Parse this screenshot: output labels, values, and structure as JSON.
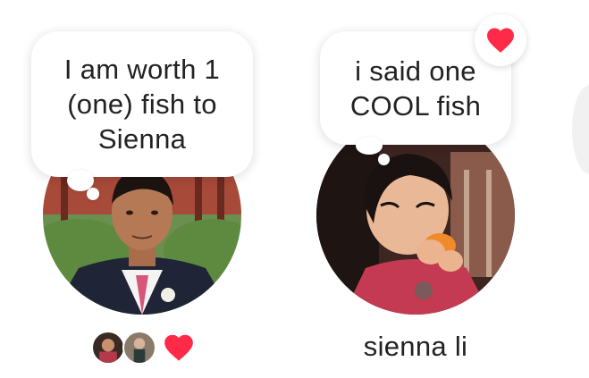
{
  "notes": [
    {
      "bubble_text": "I am worth 1\n(one) fish to\nSienna",
      "avatar": "profile-photo-young-man-suit-pink-tie",
      "reactors": [
        "reactor-avatar-1",
        "reactor-avatar-2"
      ],
      "reaction": "heart-icon"
    },
    {
      "bubble_text": "i said one\nCOOL fish",
      "avatar": "profile-photo-child-eating-orange",
      "display_name": "sienna li",
      "reaction": "heart-icon"
    }
  ],
  "colors": {
    "heart": "#ff2a48",
    "text": "#222222",
    "bubble_bg": "#ffffff"
  }
}
